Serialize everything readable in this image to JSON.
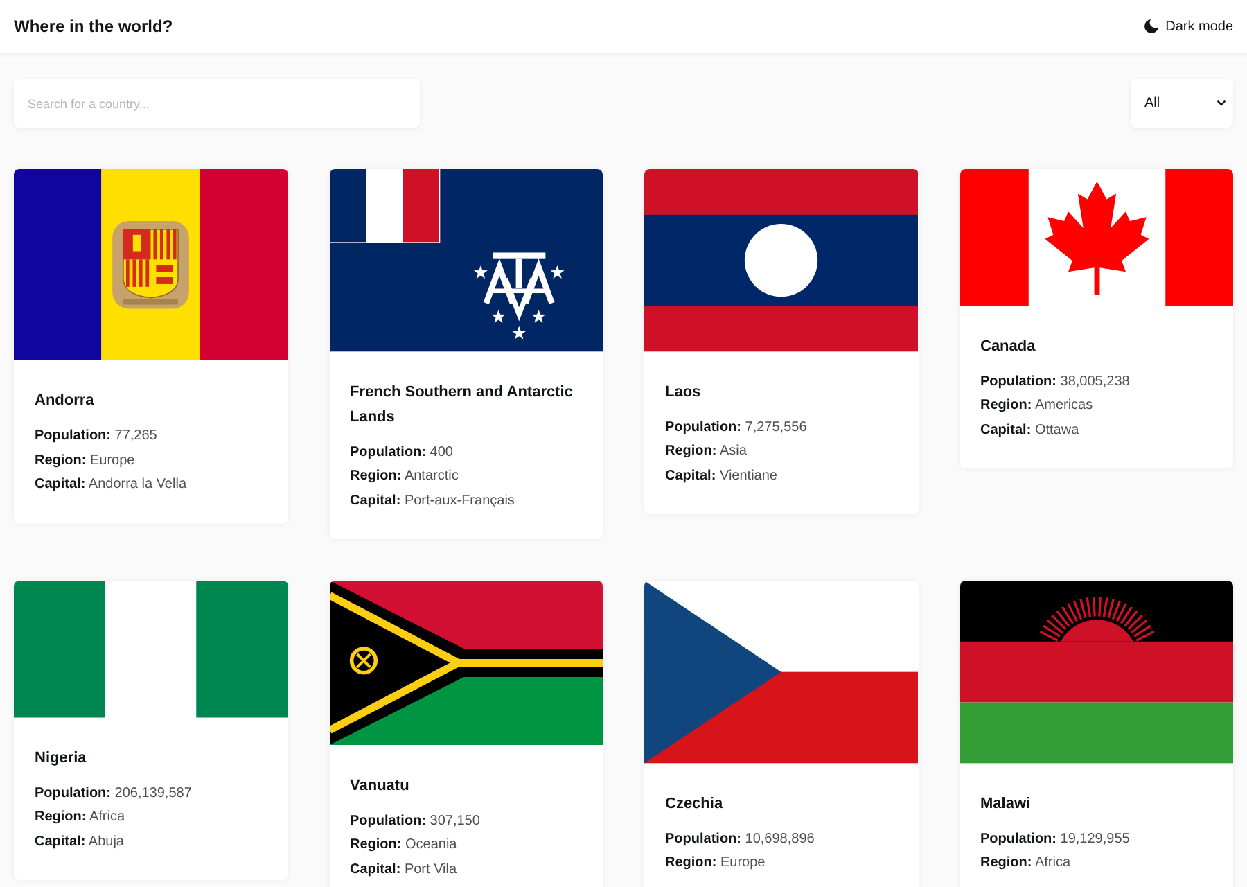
{
  "header": {
    "title": "Where in the world?",
    "theme_toggle": "Dark mode"
  },
  "search": {
    "placeholder": "Search for a country..."
  },
  "region_filter": {
    "value": "All"
  },
  "countries": [
    {
      "kind": "andorra",
      "name": "Andorra",
      "details": [
        {
          "label": "Population:",
          "value": "77,265"
        },
        {
          "label": "Region:",
          "value": "Europe"
        },
        {
          "label": "Capital:",
          "value": "Andorra la Vella"
        }
      ]
    },
    {
      "kind": "taaf",
      "name": "French Southern and Antarctic Lands",
      "details": [
        {
          "label": "Population:",
          "value": "400"
        },
        {
          "label": "Region:",
          "value": "Antarctic"
        },
        {
          "label": "Capital:",
          "value": "Port-aux-Français"
        }
      ]
    },
    {
      "kind": "laos",
      "name": "Laos",
      "details": [
        {
          "label": "Population:",
          "value": "7,275,556"
        },
        {
          "label": "Region:",
          "value": "Asia"
        },
        {
          "label": "Capital:",
          "value": "Vientiane"
        }
      ]
    },
    {
      "kind": "canada",
      "name": "Canada",
      "details": [
        {
          "label": "Population:",
          "value": "38,005,238"
        },
        {
          "label": "Region:",
          "value": "Americas"
        },
        {
          "label": "Capital:",
          "value": "Ottawa"
        }
      ]
    },
    {
      "kind": "nigeria",
      "name": "Nigeria",
      "details": [
        {
          "label": "Population:",
          "value": "206,139,587"
        },
        {
          "label": "Region:",
          "value": "Africa"
        },
        {
          "label": "Capital:",
          "value": "Abuja"
        }
      ]
    },
    {
      "kind": "vanuatu",
      "name": "Vanuatu",
      "details": [
        {
          "label": "Population:",
          "value": "307,150"
        },
        {
          "label": "Region:",
          "value": "Oceania"
        },
        {
          "label": "Capital:",
          "value": "Port Vila"
        }
      ]
    },
    {
      "kind": "czechia",
      "name": "Czechia",
      "details": [
        {
          "label": "Population:",
          "value": "10,698,896"
        },
        {
          "label": "Region:",
          "value": "Europe"
        }
      ]
    },
    {
      "kind": "malawi",
      "name": "Malawi",
      "details": [
        {
          "label": "Population:",
          "value": "19,129,955"
        },
        {
          "label": "Region:",
          "value": "Africa"
        }
      ]
    }
  ]
}
